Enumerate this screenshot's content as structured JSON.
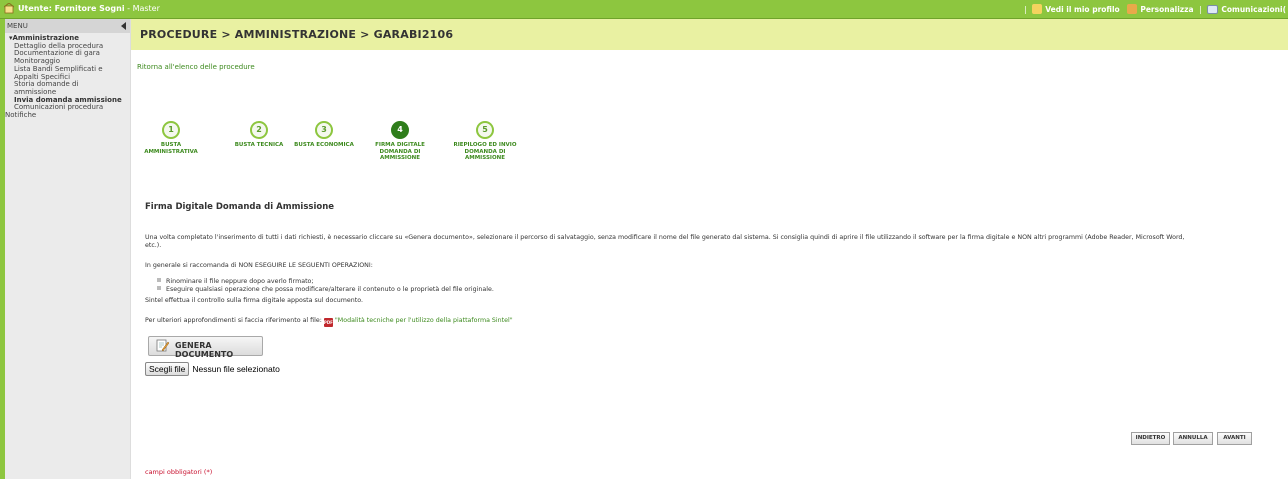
{
  "topbar": {
    "user_label": "Utente: Fornitore Sogni",
    "user_suffix": " - Master",
    "profile": "Vedi il mio profilo",
    "customize": "Personalizza",
    "communications": "Comunicazioni(",
    "separator": "|",
    "colors": {
      "bar": "#8dc63f"
    }
  },
  "sidebar": {
    "menu_label": "MENU",
    "group": "▾Amministrazione",
    "items": [
      {
        "label": "Dettaglio della procedura",
        "bold": false
      },
      {
        "label": "Documentazione di gara",
        "bold": false
      },
      {
        "label": "Monitoraggio",
        "bold": false
      },
      {
        "label": "Lista Bandi Semplificati e",
        "bold": false
      },
      {
        "label": "Appalti Specifici",
        "bold": false
      },
      {
        "label": "Storia domande di",
        "bold": false
      },
      {
        "label": "ammissione",
        "bold": false
      },
      {
        "label": "Invia domanda ammissione",
        "bold": true
      },
      {
        "label": "Comunicazioni procedura",
        "bold": false
      }
    ],
    "notifications": "Notifiche"
  },
  "breadcrumb": "PROCEDURE  > AMMINISTRAZIONE  > GARABI2106",
  "back_link": "Ritorna all'elenco delle procedure",
  "steps": [
    {
      "num": "1",
      "label": "BUSTA AMMINISTRATIVA",
      "active": false
    },
    {
      "num": "2",
      "label": "BUSTA TECNICA",
      "active": false
    },
    {
      "num": "3",
      "label": "BUSTA ECONOMICA",
      "active": false
    },
    {
      "num": "4",
      "label": "FIRMA DIGITALE DOMANDA DI AMMISSIONE",
      "active": true
    },
    {
      "num": "5",
      "label": "RIEPILOGO ED INVIO DOMANDA DI AMMISSIONE",
      "active": false
    }
  ],
  "section_title": "Firma Digitale Domanda di Ammissione",
  "paragraph1_line1": "Una volta completato l'inserimento di tutti i dati richiesti, è necessario cliccare su «Genera documento», selezionare il percorso di salvataggio, senza modificare il nome del file generato dal sistema. Si consiglia quindi di aprire il file utilizzando il software per la firma digitale e NON altri programmi (Adobe Reader, Microsoft Word,",
  "paragraph1_line2": "etc.).",
  "warning_intro": "In generale si raccomanda di NON ESEGUIRE LE SEGUENTI OPERAZIONI:",
  "bullets": [
    "Rinominare il file neppure dopo averlo firmato;",
    "Eseguire qualsiasi operazione che possa modificare/alterare il contenuto o le proprietà del file originale."
  ],
  "sintel_check": "Sintel effettua il controllo sulla firma digitale apposta sul documento.",
  "reference_prefix": "Per ulteriori approfondimenti si faccia riferimento al file:",
  "reference_link": "\"Modalità tecniche per l'utilizzo della piattaforma Sintel\"",
  "generate_button": "GENERA DOCUMENTO",
  "file_input": {
    "button": "Scegli file",
    "status": "Nessun file selezionato"
  },
  "nav_buttons": {
    "back": "INDIETRO",
    "cancel": "ANNULLA",
    "next": "AVANTI"
  },
  "required_note": "campi obbligatori (*)"
}
